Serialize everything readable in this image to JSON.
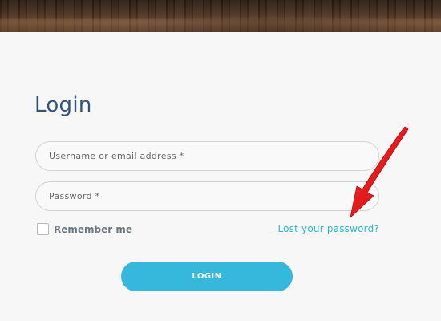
{
  "form": {
    "title": "Login",
    "username_placeholder": "Username or email address *",
    "password_placeholder": "Password *",
    "remember_label": "Remember me",
    "lost_password_link": "Lost your password?",
    "login_button_label": "LOGIN"
  },
  "colors": {
    "title": "#31557a",
    "link": "#2fb5d8",
    "button": "#35b8dc",
    "annotation_arrow": "#e01818"
  }
}
